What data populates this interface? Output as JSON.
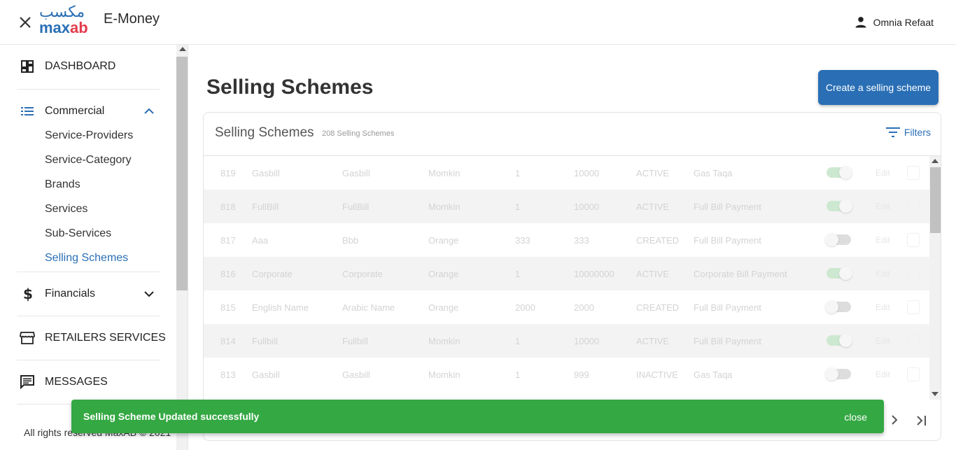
{
  "header": {
    "logo_ar": "مكسب",
    "logo_en_a": "max",
    "logo_en_b": "ab",
    "app_title": "E-Money",
    "user_name": "Omnia Refaat"
  },
  "sidebar": {
    "dashboard": "DASHBOARD",
    "commercial": "Commercial",
    "sub_items": [
      "Service-Providers",
      "Service-Category",
      "Brands",
      "Services",
      "Sub-Services",
      "Selling Schemes"
    ],
    "financials": "Financials",
    "retailers_services": "RETAILERS SERVICES",
    "messages": "MESSAGES",
    "footer": "All rights reserved MaxAB © 2021"
  },
  "main": {
    "page_title": "Selling Schemes",
    "create_button": "Create a selling scheme",
    "card_title": "Selling Schemes",
    "card_count": "208 Selling Schemes",
    "filters": "Filters",
    "edit_label": "Edit",
    "rows": [
      {
        "id": "819",
        "en": "Gasbill",
        "ar": "Gasbill",
        "provider": "Momkin",
        "min": "1",
        "max": "10000",
        "status": "ACTIVE",
        "service": "Gas Taqa",
        "enabled": true
      },
      {
        "id": "818",
        "en": "FullBill",
        "ar": "FullBill",
        "provider": "Momkin",
        "min": "1",
        "max": "10000",
        "status": "ACTIVE",
        "service": "Full Bill Payment",
        "enabled": true
      },
      {
        "id": "817",
        "en": "Aaa",
        "ar": "Bbb",
        "provider": "Orange",
        "min": "333",
        "max": "333",
        "status": "CREATED",
        "service": "Full Bill Payment",
        "enabled": false
      },
      {
        "id": "816",
        "en": "Corporate",
        "ar": "Corporate",
        "provider": "Orange",
        "min": "1",
        "max": "10000000",
        "status": "ACTIVE",
        "service": "Corporate Bill Payment",
        "enabled": true
      },
      {
        "id": "815",
        "en": "English Name",
        "ar": "Arabic Name",
        "provider": "Orange",
        "min": "2000",
        "max": "2000",
        "status": "CREATED",
        "service": "Full Bill Payment",
        "enabled": false
      },
      {
        "id": "814",
        "en": "Fullbill",
        "ar": "Fullbill",
        "provider": "Momkin",
        "min": "1",
        "max": "10000",
        "status": "ACTIVE",
        "service": "Full Bill Payment",
        "enabled": true
      },
      {
        "id": "813",
        "en": "Gasbill",
        "ar": "Gasbill",
        "provider": "Momkin",
        "min": "1",
        "max": "999",
        "status": "INACTIVE",
        "service": "Gas Taqa",
        "enabled": false
      }
    ]
  },
  "toast": {
    "message": "Selling Scheme Updated successfully",
    "close": "close"
  },
  "colors": {
    "brand_blue": "#2a6fb5",
    "brand_red": "#e23b4b",
    "toast_green": "#34a843"
  }
}
